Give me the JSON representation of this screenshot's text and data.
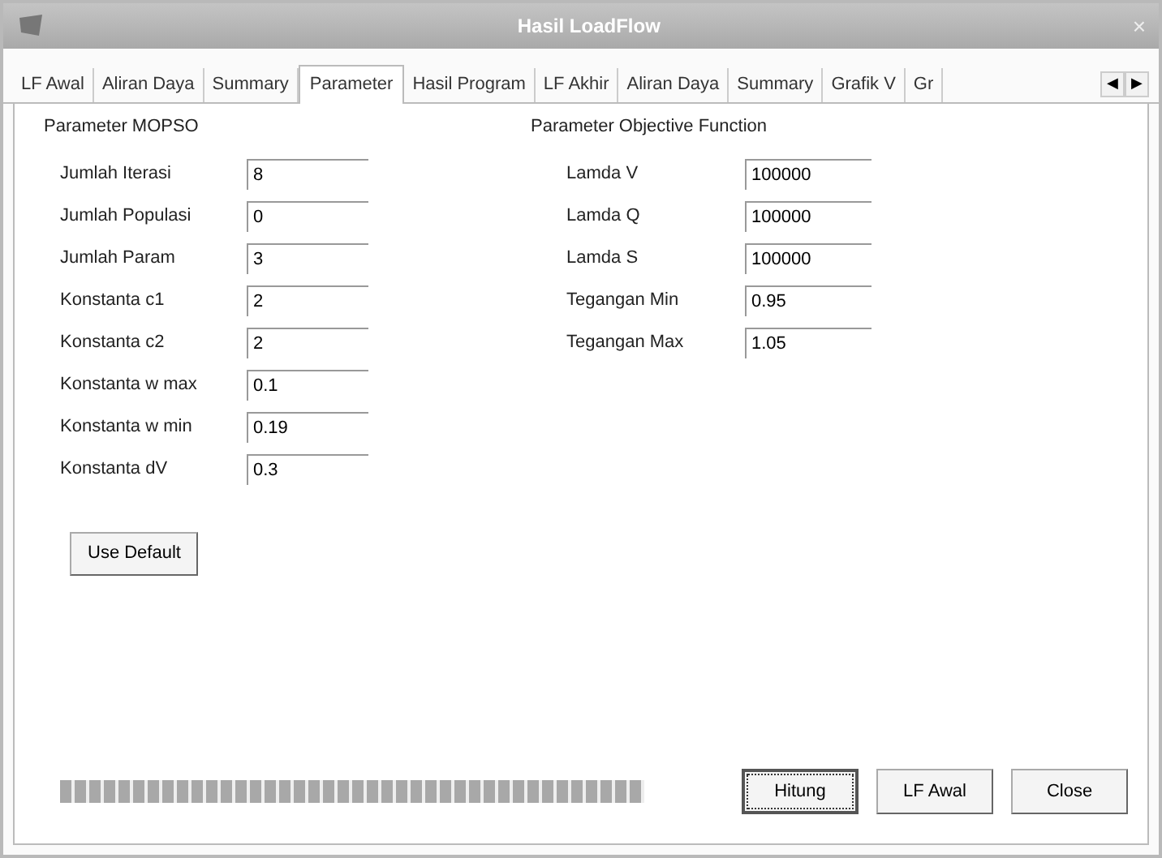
{
  "window": {
    "title": "Hasil LoadFlow",
    "close": "×"
  },
  "tabs": [
    {
      "label": "LF Awal",
      "selected": false
    },
    {
      "label": "Aliran Daya",
      "selected": false
    },
    {
      "label": "Summary",
      "selected": false
    },
    {
      "label": "Parameter",
      "selected": true
    },
    {
      "label": "Hasil Program",
      "selected": false
    },
    {
      "label": "LF Akhir",
      "selected": false
    },
    {
      "label": "Aliran Daya",
      "selected": false
    },
    {
      "label": "Summary",
      "selected": false
    },
    {
      "label": "Grafik V",
      "selected": false
    },
    {
      "label": "Gr",
      "selected": false
    }
  ],
  "tab_scroll": [
    "◀",
    "▶"
  ],
  "groups": [
    {
      "title": "Parameter MOPSO",
      "fields": [
        {
          "label": "Jumlah Iterasi",
          "value": "8"
        },
        {
          "label": "Jumlah Populasi",
          "value": "0"
        },
        {
          "label": "Jumlah Param",
          "value": "3"
        },
        {
          "label": "Konstanta c1",
          "value": "2"
        },
        {
          "label": "Konstanta c2",
          "value": "2"
        },
        {
          "label": "Konstanta w max",
          "value": "0.1"
        },
        {
          "label": "Konstanta w min",
          "value": "0.19"
        },
        {
          "label": "Konstanta dV",
          "value": "0.3"
        }
      ],
      "button": "Use Default"
    },
    {
      "title": "Parameter Objective Function",
      "fields": [
        {
          "label": "Lamda V",
          "value": "100000"
        },
        {
          "label": "Lamda Q",
          "value": "100000"
        },
        {
          "label": "Lamda S",
          "value": "100000"
        },
        {
          "label": "Tegangan Min",
          "value": "0.95"
        },
        {
          "label": "Tegangan Max",
          "value": "1.05"
        }
      ]
    }
  ],
  "progress": {
    "level": 1
  },
  "buttons": [
    {
      "label": "Hitung",
      "focused": true
    },
    {
      "label": "LF Awal",
      "focused": false
    },
    {
      "label": "Close",
      "focused": false
    }
  ]
}
